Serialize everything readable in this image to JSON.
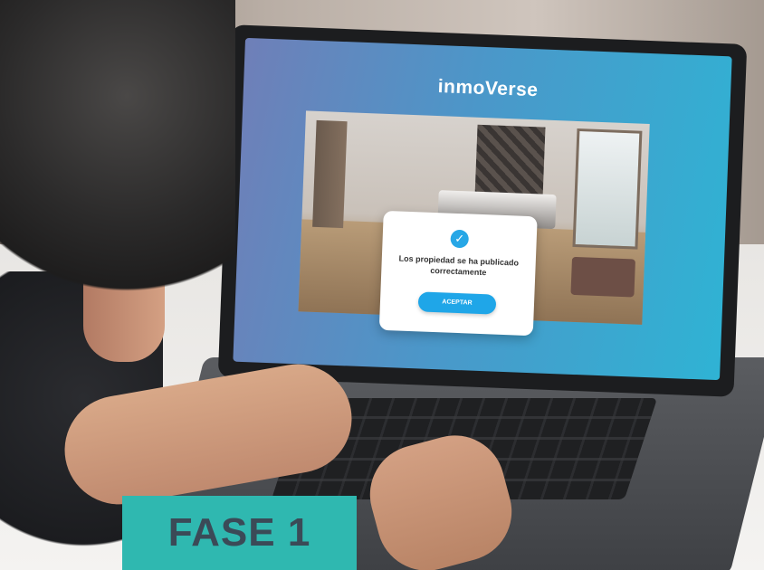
{
  "screen": {
    "logo_text": "inmoVerse",
    "modal": {
      "message": "Los propiedad se ha publicado correctamente",
      "button_label": "ACEPTAR"
    }
  },
  "overlay_badge": {
    "label": "FASE 1",
    "color": "#2fb8b0"
  },
  "colors": {
    "screen_gradient_start": "#6f7fb8",
    "screen_gradient_end": "#2fb3d4",
    "button": "#1fa6e8"
  },
  "icons": {
    "success": "check-icon"
  }
}
